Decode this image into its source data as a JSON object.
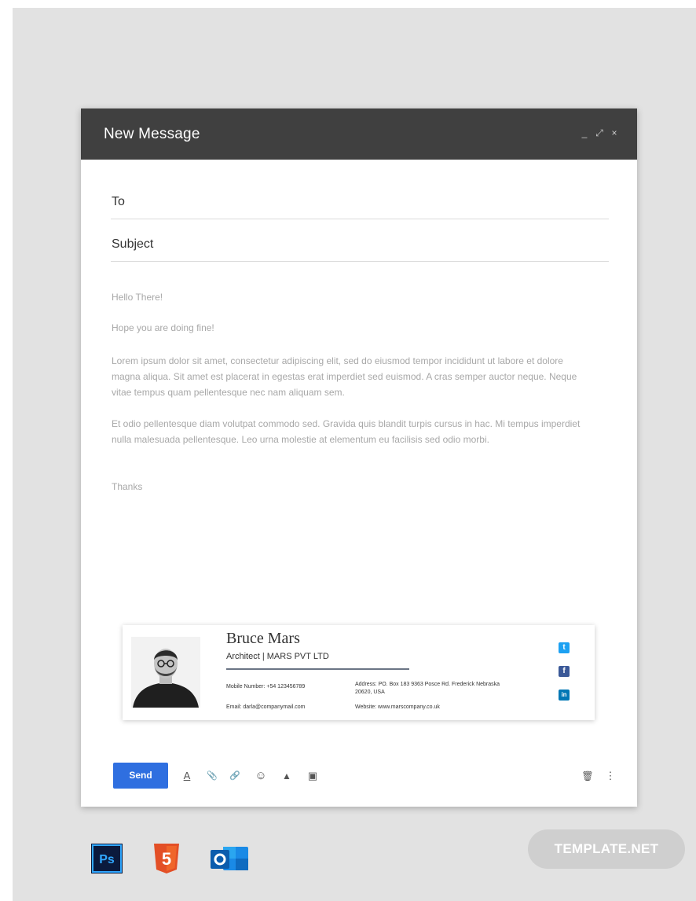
{
  "window": {
    "title": "New Message",
    "controls": {
      "minimize": "_",
      "expand": "⤢",
      "close": "×"
    }
  },
  "fields": {
    "to_label": "To",
    "subject_label": "Subject"
  },
  "message": {
    "greeting": "Hello There!",
    "line2": "Hope you are doing fine!",
    "para1": "Lorem ipsum dolor sit amet, consectetur adipiscing elit, sed do eiusmod tempor incididunt ut labore et dolore magna aliqua. Sit amet est placerat in egestas erat imperdiet sed euismod. A cras semper auctor neque. Neque vitae tempus quam pellentesque nec nam aliquam sem.",
    "para2": " Et odio pellentesque diam volutpat commodo sed. Gravida quis blandit turpis cursus in hac. Mi tempus imperdiet nulla malesuada pellentesque. Leo urna molestie at elementum eu facilisis sed odio morbi.",
    "signoff": "Thanks"
  },
  "signature": {
    "name": "Bruce Mars",
    "role": "Architect | MARS PVT LTD",
    "mobile": "Mobile Number: +54 123456789",
    "email": "Email: darla@companymail.com",
    "address": "Address: PO. Box 183 9363 Posce Rd. Frederick Nebraska 20620, USA",
    "website": "Website: www.marscompany.co.uk",
    "social": {
      "twitter": "t",
      "facebook": "f",
      "linkedin": "in"
    },
    "colors": {
      "twitter": "#1da1f2",
      "facebook": "#3b5998",
      "linkedin": "#0077b5"
    }
  },
  "toolbar": {
    "send_label": "Send",
    "format_icon": "A",
    "attach_icon": "📎",
    "link_icon": "🔗",
    "emoji_icon": "☺",
    "drive_icon": "▲",
    "photo_icon": "▣",
    "trash_icon": "🗑",
    "more_icon": "⋮"
  },
  "apps": {
    "photoshop_label": "Ps",
    "html5_label": "5"
  },
  "watermark": {
    "text": "TEMPLATE.NET"
  },
  "colors": {
    "titlebar": "#404040",
    "send_button": "#2f6fe0",
    "background": "#e2e2e2"
  }
}
